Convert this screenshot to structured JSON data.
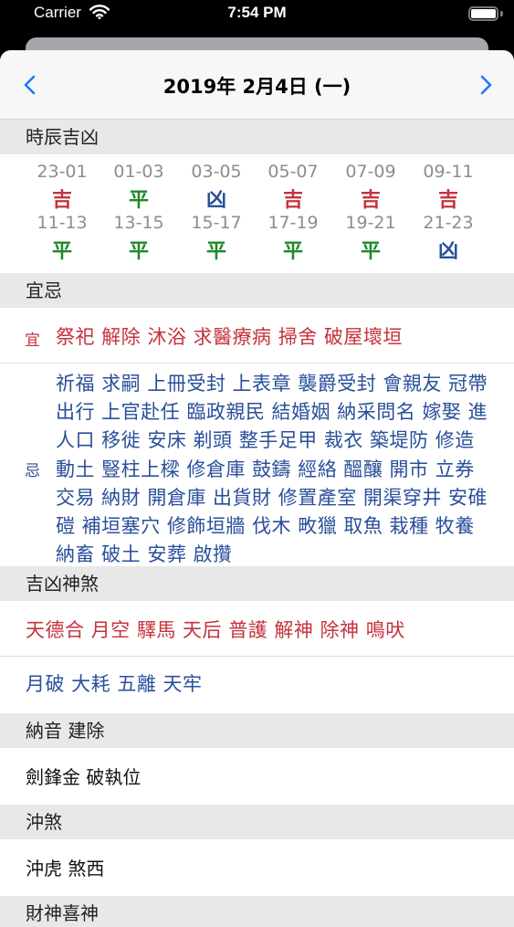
{
  "status_bar": {
    "carrier": "Carrier",
    "time": "7:54 PM"
  },
  "nav": {
    "title": "2019年 2月4日 (一)",
    "prev_icon": "chevron-left-icon",
    "next_icon": "chevron-right-icon"
  },
  "sections": {
    "hours": "時辰吉凶",
    "yiji": "宜忌",
    "shensha": "吉凶神煞",
    "nayin": "納音 建除",
    "chongsha": "沖煞",
    "caishen": "財神喜神"
  },
  "hours": [
    {
      "range": "23-01",
      "mark": "吉",
      "color": "#c5323c"
    },
    {
      "range": "01-03",
      "mark": "平",
      "color": "#1e8a2a"
    },
    {
      "range": "03-05",
      "mark": "凶",
      "color": "#2a4f9a"
    },
    {
      "range": "05-07",
      "mark": "吉",
      "color": "#c5323c"
    },
    {
      "range": "07-09",
      "mark": "吉",
      "color": "#c5323c"
    },
    {
      "range": "09-11",
      "mark": "吉",
      "color": "#c5323c"
    },
    {
      "range": "11-13",
      "mark": "平",
      "color": "#1e8a2a"
    },
    {
      "range": "13-15",
      "mark": "平",
      "color": "#1e8a2a"
    },
    {
      "range": "15-17",
      "mark": "平",
      "color": "#1e8a2a"
    },
    {
      "range": "17-19",
      "mark": "平",
      "color": "#1e8a2a"
    },
    {
      "range": "19-21",
      "mark": "平",
      "color": "#1e8a2a"
    },
    {
      "range": "21-23",
      "mark": "凶",
      "color": "#2a4f9a"
    }
  ],
  "yiji": {
    "yi_label": "宜",
    "yi": "祭祀 解除 沐浴 求醫療病 掃舍 破屋壞垣",
    "ji_label": "忌",
    "ji": "祈福 求嗣 上冊受封 上表章 襲爵受封 會親友 冠帶 出行 上官赴任 臨政親民 結婚姻 納采問名 嫁娶 進人口 移徙 安床 剃頭 整手足甲 裁衣 築堤防 修造動土 豎柱上樑 修倉庫 鼓鑄 經絡 醞釀 開市 立券 交易 納財 開倉庫 出貨財 修置產室 開渠穿井 安碓磑 補垣塞穴 修飾垣牆 伐木 畋獵 取魚 栽種 牧養 納畜 破土 安葬 啟攢"
  },
  "shensha": {
    "good": "天德合 月空 驛馬 天后 普護 解神 除神 鳴吠",
    "bad": "月破 大耗 五離 天牢"
  },
  "nayin": "劍鋒金  破執位",
  "chongsha": "沖虎  煞西",
  "colors": {
    "red": "#c5323c",
    "green": "#1e8a2a",
    "blue": "#2a4f9a",
    "accent": "#1a7bf2"
  }
}
